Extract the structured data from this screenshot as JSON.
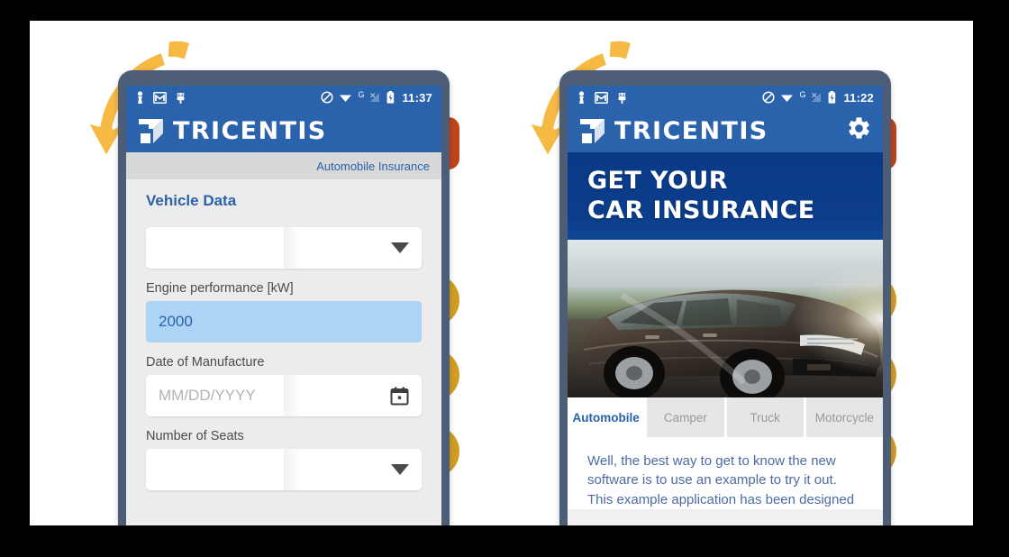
{
  "canvas": {
    "background": "#ffffff",
    "frame_color": "#000000"
  },
  "theme": {
    "brand_blue": "#2a62ab",
    "hero_blue": "#0b3a85",
    "bezel": "#4d5d75",
    "arrow_orange": "#f5b944",
    "close_red": "#c0431a",
    "action_amber": "#d19c22",
    "filled_input": "#aed4f5"
  },
  "side_buttons": [
    {
      "name": "close",
      "glyph": "x",
      "shape": "rounded-square",
      "color": "#c0431a"
    },
    {
      "name": "stop",
      "glyph": "square",
      "shape": "circle",
      "color": "#d19c22"
    },
    {
      "name": "record",
      "glyph": "circle",
      "shape": "circle",
      "color": "#d19c22"
    },
    {
      "name": "play",
      "glyph": "triangle",
      "shape": "circle",
      "color": "#d19c22"
    }
  ],
  "phone_left": {
    "status_bar": {
      "time": "11:37",
      "left_icons": [
        "person-icon",
        "gmail-icon",
        "android-bug-icon"
      ],
      "right_icons": [
        "do-not-disturb-icon",
        "wifi-icon",
        "g-network-icon",
        "signal-off-icon",
        "battery-charging-icon"
      ]
    },
    "app_bar": {
      "logo_text": "TRICENTIS",
      "logo_icon": "tricentis-logo-icon"
    },
    "breadcrumb": "Automobile Insurance",
    "section_title": "Vehicle Data",
    "fields": [
      {
        "label": "",
        "type": "select",
        "value": "",
        "icon": "chevron-down-icon"
      },
      {
        "label": "Engine performance [kW]",
        "type": "text",
        "value": "2000",
        "state": "filled"
      },
      {
        "label": "Date of Manufacture",
        "type": "date",
        "placeholder": "MM/DD/YYYY",
        "icon": "calendar-icon"
      },
      {
        "label": "Number of Seats",
        "type": "select",
        "value": "",
        "icon": "chevron-down-icon"
      }
    ]
  },
  "phone_right": {
    "status_bar": {
      "time": "11:22",
      "left_icons": [
        "person-icon",
        "gmail-icon",
        "android-bug-icon"
      ],
      "right_icons": [
        "do-not-disturb-icon",
        "wifi-icon",
        "g-network-icon",
        "signal-off-icon",
        "battery-charging-icon"
      ]
    },
    "app_bar": {
      "logo_text": "TRICENTIS",
      "logo_icon": "tricentis-logo-icon",
      "settings_icon": "gear-icon"
    },
    "hero": {
      "line1": "GET YOUR",
      "line2": "CAR INSURANCE",
      "image": "car-photo"
    },
    "tabs": [
      {
        "label": "Automobile",
        "active": true
      },
      {
        "label": "Camper",
        "active": false
      },
      {
        "label": "Truck",
        "active": false
      },
      {
        "label": "Motorcycle",
        "active": false
      }
    ],
    "body": {
      "line1": "Well, the best way to get to know the new",
      "line2": "software is to use an example to try it out.",
      "line3": "This example application has been designed"
    }
  }
}
